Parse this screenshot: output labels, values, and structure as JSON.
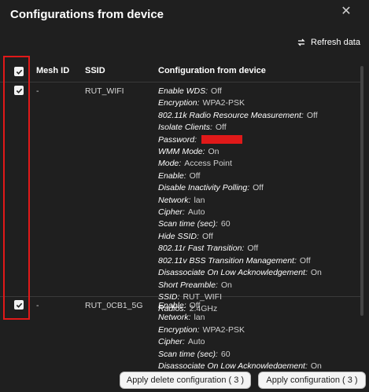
{
  "dialog": {
    "title": "Configurations from device",
    "refresh_label": "Refresh data"
  },
  "table": {
    "headers": {
      "mesh_id": "Mesh ID",
      "ssid": "SSID",
      "config": "Configuration from device"
    },
    "rows": [
      {
        "mesh_id": "-",
        "ssid": "RUT_WIFI",
        "config": [
          {
            "k": "Enable WDS:",
            "v": "Off"
          },
          {
            "k": "Encryption:",
            "v": "WPA2-PSK"
          },
          {
            "k": "802.11k Radio Resource Measurement:",
            "v": "Off"
          },
          {
            "k": "Isolate Clients:",
            "v": "Off"
          },
          {
            "k": "Password:",
            "v": ""
          },
          {
            "k": "WMM Mode:",
            "v": "On"
          },
          {
            "k": "Mode:",
            "v": "Access Point"
          },
          {
            "k": "Enable:",
            "v": "Off"
          },
          {
            "k": "Disable Inactivity Polling:",
            "v": "Off"
          },
          {
            "k": "Network:",
            "v": "lan"
          },
          {
            "k": "Cipher:",
            "v": "Auto"
          },
          {
            "k": "Scan time (sec):",
            "v": "60"
          },
          {
            "k": "Hide SSID:",
            "v": "Off"
          },
          {
            "k": "802.11r Fast Transition:",
            "v": "Off"
          },
          {
            "k": "802.11v BSS Transition Management:",
            "v": "Off"
          },
          {
            "k": "Disassociate On Low Acknowledgement:",
            "v": "On"
          },
          {
            "k": "Short Preamble:",
            "v": "On"
          },
          {
            "k": "SSID:",
            "v": "RUT_WIFI"
          },
          {
            "k": "Radios:",
            "v": "2.4GHz"
          }
        ]
      },
      {
        "mesh_id": "-",
        "ssid": "RUT_0CB1_5G",
        "config": [
          {
            "k": "Enable:",
            "v": "Off"
          },
          {
            "k": "Network:",
            "v": "lan"
          },
          {
            "k": "Encryption:",
            "v": "WPA2-PSK"
          },
          {
            "k": "Cipher:",
            "v": "Auto"
          },
          {
            "k": "Scan time (sec):",
            "v": "60"
          },
          {
            "k": "Disassociate On Low Acknowledgement:",
            "v": "On"
          }
        ]
      }
    ]
  },
  "footer": {
    "apply_delete_label": "Apply delete configuration ( 3 )",
    "apply_label": "Apply configuration ( 3 )"
  },
  "colors": {
    "background": "#1f1f1f",
    "highlight": "#e01919"
  }
}
